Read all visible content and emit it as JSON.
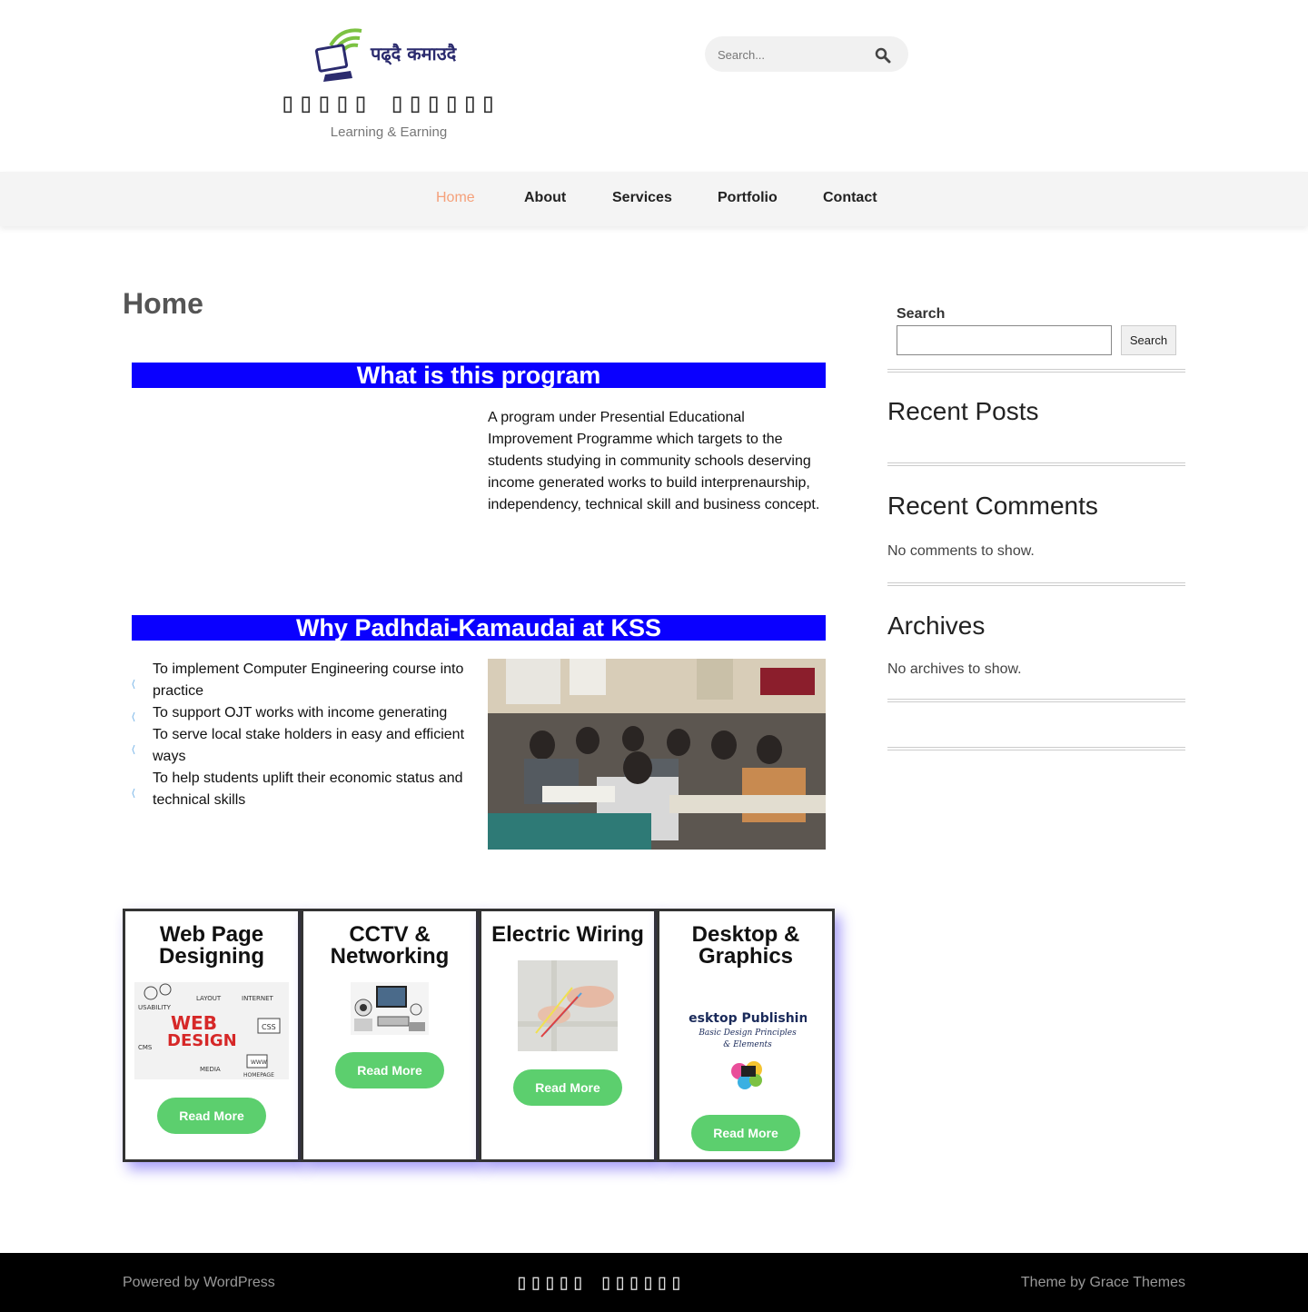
{
  "header": {
    "logo_text": "पढ्दै कमाउदै",
    "site_title": "▯▯▯▯▯ ▯▯▯▯▯▯",
    "tagline": "Learning & Earning",
    "search_placeholder": "Search...",
    "search_icon": "search-icon"
  },
  "nav": {
    "items": [
      {
        "label": "Home",
        "active": true
      },
      {
        "label": "About",
        "active": false
      },
      {
        "label": "Services",
        "active": false
      },
      {
        "label": "Portfolio",
        "active": false
      },
      {
        "label": "Contact",
        "active": false
      }
    ],
    "active_color": "#f5a07a"
  },
  "main": {
    "page_title": "Home",
    "program_heading": "What is this program",
    "program_text": "A program under Presential Educational Improvement Programme which targets to the students studying in community schools deserving income generated works to build interprenaurship, independency, technical skill and business concept.",
    "why_heading": "Why Padhdai-Kamaudai at KSS",
    "why_items": [
      "To implement Computer Engineering course into practice",
      "To support OJT works with income generating",
      "To serve local stake holders in easy and efficient ways",
      "To help students uplift their economic status and technical skills"
    ],
    "band_color": "#0a00ff",
    "cards": [
      {
        "title": "Web Page Designing",
        "button": "Read More"
      },
      {
        "title": "CCTV & Networking",
        "button": "Read More"
      },
      {
        "title": "Electric Wiring",
        "button": "Read More"
      },
      {
        "title": "Desktop & Graphics",
        "button": "Read More"
      }
    ],
    "web_design_image": {
      "words": [
        "USABILITY",
        "LAYOUT",
        "INTERNET",
        "WEB",
        "DESIGN",
        "CSS",
        "CMS",
        "MEDIA",
        "WWW",
        "HOMEPAGE"
      ]
    },
    "desktop_image": {
      "title": "Desktop Publishing",
      "subtitle": "Basic Design Principles",
      "subtitle2": "& Elements"
    },
    "button_color": "#5ccf6e"
  },
  "sidebar": {
    "search_label": "Search",
    "search_button": "Search",
    "recent_posts": "Recent Posts",
    "recent_comments": "Recent Comments",
    "comments_empty": "No comments to show.",
    "archives": "Archives",
    "archives_empty": "No archives to show."
  },
  "footer": {
    "left": "Powered by WordPress",
    "center": "▯▯▯▯▯ ▯▯▯▯▯▯",
    "right": "Theme by Grace Themes"
  }
}
